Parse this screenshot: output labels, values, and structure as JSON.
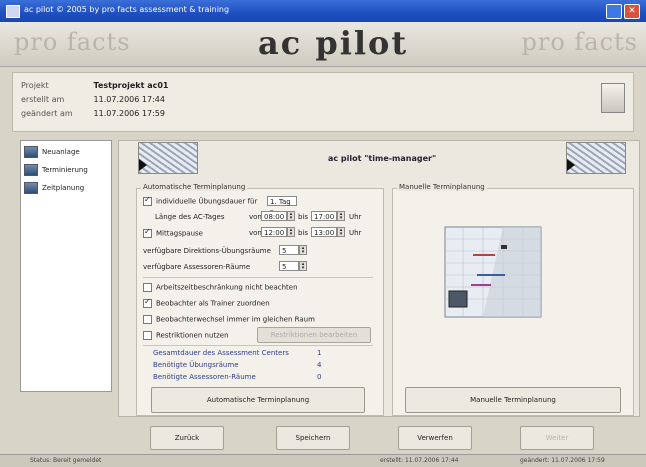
{
  "window": {
    "title": "ac pilot  © 2005 by pro facts assessment & training"
  },
  "banner": {
    "brand_left": "pro facts",
    "brand_center": "ac pilot",
    "brand_right": "pro facts"
  },
  "project": {
    "rows": [
      {
        "label": "Projekt",
        "value": "Testprojekt ac01"
      },
      {
        "label": "erstellt am",
        "value": "11.07.2006  17:44"
      },
      {
        "label": "geändert am",
        "value": "11.07.2006  17:59"
      }
    ]
  },
  "sidebar": {
    "items": [
      {
        "label": "Neuanlage",
        "icon": "doc-icon"
      },
      {
        "label": "Terminierung",
        "icon": "calendar-icon"
      },
      {
        "label": "Zeitplanung",
        "icon": "schedule-icon"
      }
    ]
  },
  "header": {
    "caption": "ac pilot \"time-manager\""
  },
  "auto_planning": {
    "title": "Automatische Terminplanung",
    "individual_durations": {
      "label": "individuelle Übungsdauer für",
      "checked": true,
      "select_value": "1. Tag"
    },
    "ac_day": {
      "label": "Länge des AC-Tages",
      "from": "von",
      "from_value": "08:00",
      "to": "bis",
      "to_value": "17:00",
      "unit": "Uhr"
    },
    "lunch": {
      "label": "Mittagspause",
      "checked": true,
      "from": "von",
      "from_value": "12:00",
      "to": "bis",
      "to_value": "13:00",
      "unit": "Uhr"
    },
    "min_exercise": {
      "label": "verfügbare Direktions-Übungsräume",
      "value": "5"
    },
    "assessor_rooms": {
      "label": "verfügbare Assessoren-Räume",
      "value": "5"
    },
    "checkboxes": [
      {
        "label": "Arbeitszeitbeschränkung nicht beachten",
        "checked": false
      },
      {
        "label": "Beobachter als Trainer zuordnen",
        "checked": true
      },
      {
        "label": "Beobachterwechsel immer im gleichen Raum",
        "checked": false
      },
      {
        "label": "Restriktionen nutzen",
        "checked": false
      }
    ],
    "restriction_button": "Restriktionen bearbeiten",
    "stats": [
      {
        "label": "Gesamtdauer des Assessment Centers",
        "value": "1"
      },
      {
        "label": "Benötigte Übungsräume",
        "value": "4"
      },
      {
        "label": "Benötigte Assessoren-Räume",
        "value": "0"
      }
    ],
    "button": "Automatische Terminplanung"
  },
  "manual_planning": {
    "title": "Manuelle Terminplanung",
    "button": "Manuelle Terminplanung"
  },
  "footer": {
    "back": "Zurück",
    "save": "Speichern",
    "discard": "Verwerfen",
    "next": "Weiter"
  },
  "statusbar": {
    "status": "Status: Bereit gemeldet",
    "created": "erstellt:  11.07.2006  17:44",
    "modified": "geändert:  11.07.2006  17:59"
  }
}
